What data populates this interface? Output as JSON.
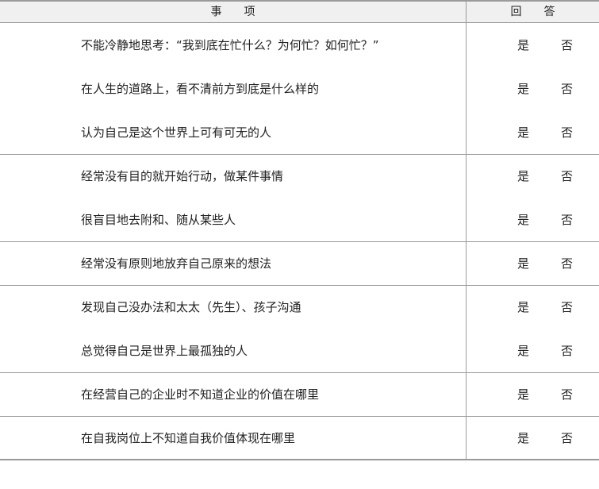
{
  "header": {
    "item_label": "事　　项",
    "answer_label": "回　　答"
  },
  "rows": [
    {
      "question": "不能冷静地思考：“我到底在忙什么？为何忙？如何忙？”",
      "yes": "是",
      "no": "否"
    },
    {
      "question": "在人生的道路上，看不清前方到底是什么样的",
      "yes": "是",
      "no": "否"
    },
    {
      "question": "认为自己是这个世界上可有可无的人",
      "yes": "是",
      "no": "否"
    },
    {
      "question": "经常没有目的就开始行动，做某件事情",
      "yes": "是",
      "no": "否"
    },
    {
      "question": "很盲目地去附和、随从某些人",
      "yes": "是",
      "no": "否"
    },
    {
      "question": "经常没有原则地放弃自己原来的想法",
      "yes": "是",
      "no": "否"
    },
    {
      "question": "发现自己没办法和太太（先生）、孩子沟通",
      "yes": "是",
      "no": "否"
    },
    {
      "question": "总觉得自己是世界上最孤独的人",
      "yes": "是",
      "no": "否"
    },
    {
      "question": "在经营自己的企业时不知道企业的价值在哪里",
      "yes": "是",
      "no": "否"
    },
    {
      "question": "在自我岗位上不知道自我价值体现在哪里",
      "yes": "是",
      "no": "否"
    }
  ]
}
